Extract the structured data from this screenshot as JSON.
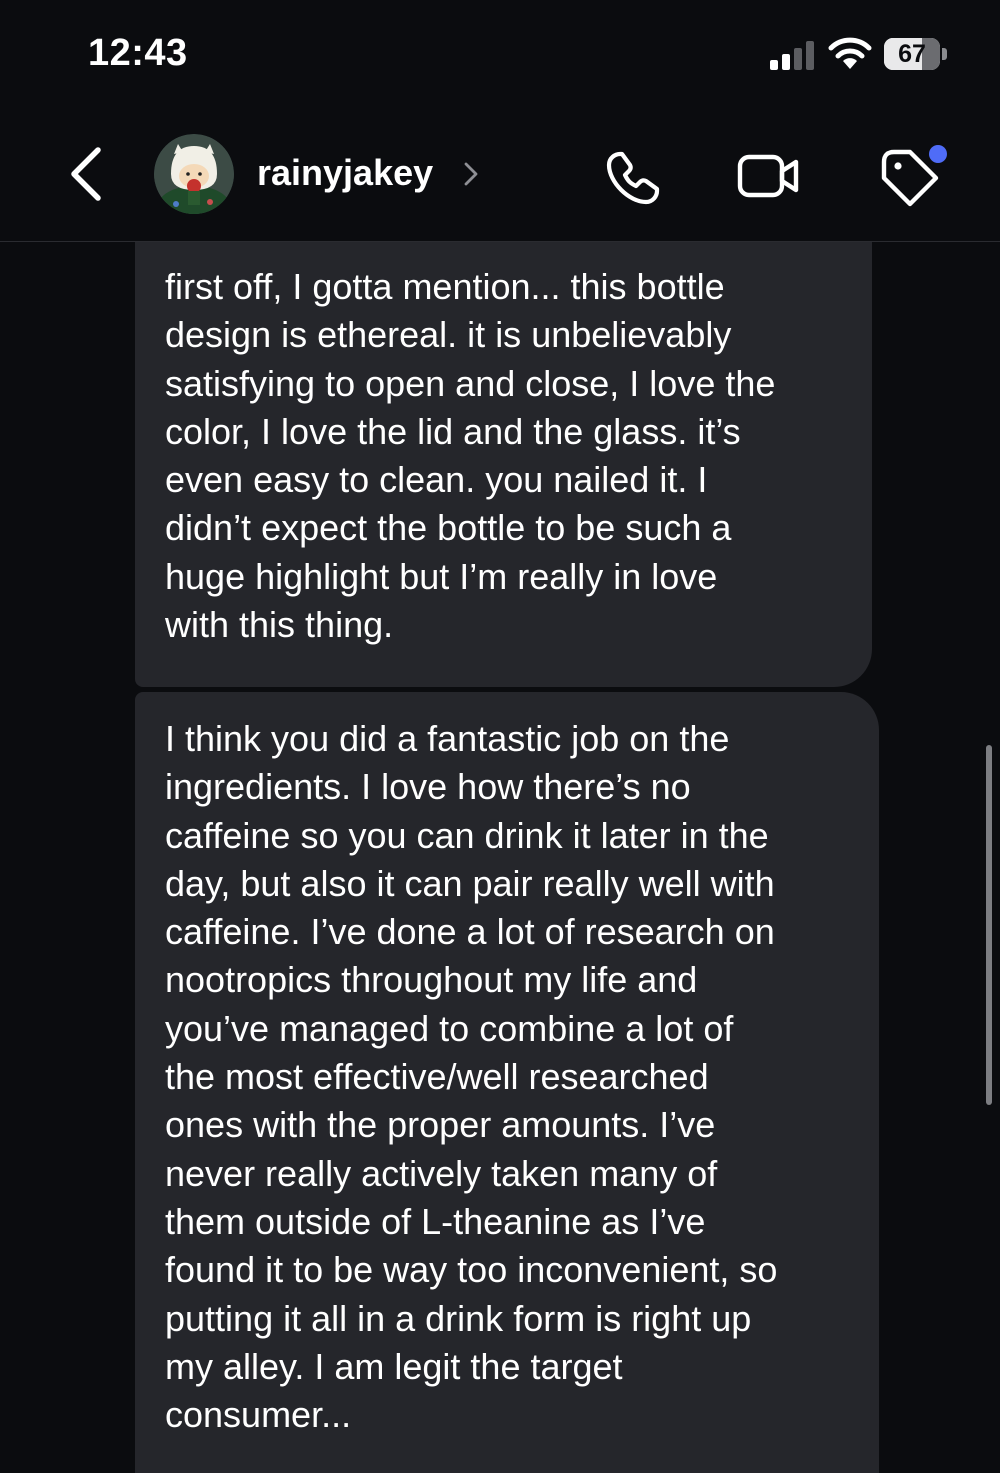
{
  "status_bar": {
    "time": "12:43",
    "battery_percent": 67,
    "battery_label": "67",
    "signal_bars_active": 2,
    "signal_bars_total": 4
  },
  "header": {
    "contact_name": "rainyjakey",
    "back_icon": "chevron-left-icon",
    "call_icon": "phone-icon",
    "video_icon": "video-camera-icon",
    "tag_icon": "tag-icon",
    "tag_badge_color": "#4f6cf7"
  },
  "messages": [
    {
      "text": "first off, I gotta mention... this bottle\ndesign is ethereal. it is unbelievably\nsatisfying to open and close, I love the\ncolor, I love the lid and the glass. it’s\neven easy to clean. you nailed it. I\ndidn’t expect the bottle to be such a\nhuge highlight but I’m really in love\nwith this thing."
    },
    {
      "text": "I think you did a fantastic job on the\ningredients. I love how there’s no\ncaffeine so you can drink it later in the\nday, but also it can pair really well with\ncaffeine. I’ve done a lot of research on\nnootropics throughout my life and\nyou’ve managed to combine a lot of\nthe most effective/well researched\nones with the proper amounts. I’ve\nnever really actively taken many of\nthem outside of L-theanine as I’ve\nfound it to be way too inconvenient, so\nputting it all in a drink form is right up\nmy alley. I am legit the target\nconsumer..."
    }
  ],
  "colors": {
    "background": "#0b0c0f",
    "bubble": "#25262b",
    "text": "#ffffff",
    "accent": "#4f6cf7"
  }
}
